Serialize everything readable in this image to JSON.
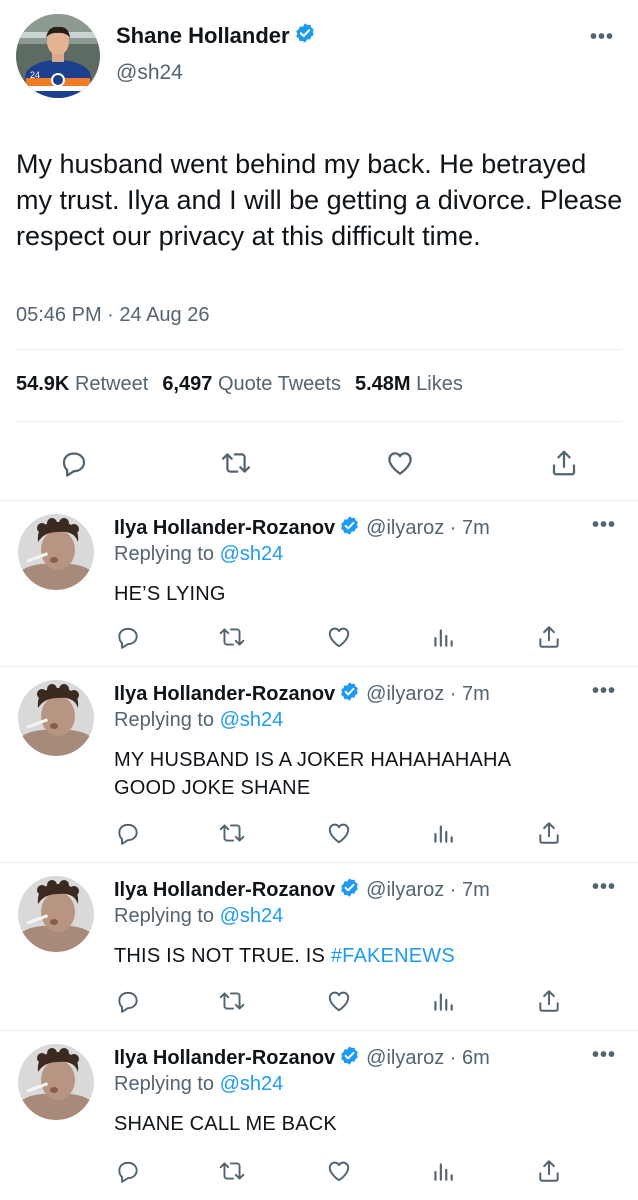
{
  "main_tweet": {
    "name": "Shane Hollander",
    "handle": "@sh24",
    "text": "My husband went behind my back. He betrayed my trust. Ilya and I will be getting a divorce. Please respect our privacy at this difficult time.",
    "timestamp": "05:46 PM · 24 Aug 26",
    "more_icon": "more-horizontal-icon",
    "stats": {
      "retweets_count": "54.9K",
      "retweets_label": "Retweet",
      "quotes_count": "6,497",
      "quotes_label": "Quote Tweets",
      "likes_count": "5.48M",
      "likes_label": "Likes"
    },
    "actions": [
      "reply-icon",
      "retweet-icon",
      "like-icon",
      "share-icon"
    ]
  },
  "replies": [
    {
      "name": "Ilya Hollander-Rozanov",
      "handle": "@ilyaroz · 7m",
      "replying_prefix": "Replying to",
      "replying_to": "@sh24",
      "text": "HE’S LYING",
      "hashtag": ""
    },
    {
      "name": "Ilya Hollander-Rozanov",
      "handle": "@ilyaroz · 7m",
      "replying_prefix": "Replying to",
      "replying_to": "@sh24",
      "text": "MY HUSBAND IS A JOKER HAHAHAHAHA GOOD JOKE SHANE",
      "hashtag": ""
    },
    {
      "name": "Ilya Hollander-Rozanov",
      "handle": "@ilyaroz · 7m",
      "replying_prefix": "Replying to",
      "replying_to": "@sh24",
      "text": "THIS IS NOT TRUE. IS ",
      "hashtag": "#FAKENEWS"
    },
    {
      "name": "Ilya Hollander-Rozanov",
      "handle": "@ilyaroz · 6m",
      "replying_prefix": "Replying to",
      "replying_to": "@sh24",
      "text": "SHANE CALL ME BACK",
      "hashtag": ""
    }
  ],
  "colors": {
    "accent": "#1d9bf0",
    "secondary_text": "#536471",
    "divider": "#e6ecf0"
  }
}
